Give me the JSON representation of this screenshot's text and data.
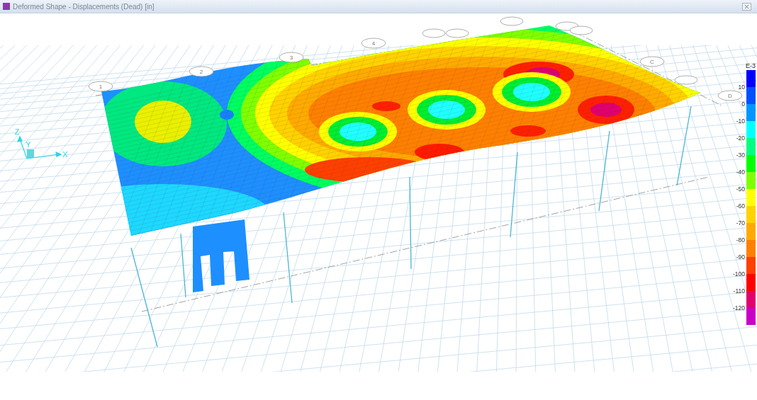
{
  "window": {
    "title": "Deformed Shape - Displacements (Dead)  [in]"
  },
  "grid_bubbles": [
    {
      "label": "1"
    },
    {
      "label": "2"
    },
    {
      "label": "3"
    },
    {
      "label": "4"
    },
    {
      "label": "C"
    },
    {
      "label": "D"
    }
  ],
  "axes": {
    "x": "X",
    "y": "Y",
    "z": "Z"
  },
  "legend": {
    "title": "E-3",
    "bands": [
      {
        "color": "#0000ff",
        "label": "10"
      },
      {
        "color": "#0050ff",
        "label": "0"
      },
      {
        "color": "#0096ff",
        "label": "-10"
      },
      {
        "color": "#00ffff",
        "label": "-20"
      },
      {
        "color": "#00ff80",
        "label": "-30"
      },
      {
        "color": "#00ff00",
        "label": "-40"
      },
      {
        "color": "#80ff00",
        "label": "-50"
      },
      {
        "color": "#ffff00",
        "label": "-60"
      },
      {
        "color": "#ffd200",
        "label": "-70"
      },
      {
        "color": "#ffaa00",
        "label": "-80"
      },
      {
        "color": "#ff8000",
        "label": "-90"
      },
      {
        "color": "#ff4000",
        "label": "-100"
      },
      {
        "color": "#ff0000",
        "label": "-110"
      },
      {
        "color": "#e0006e",
        "label": "-120"
      },
      {
        "color": "#c800c8"
      }
    ]
  }
}
